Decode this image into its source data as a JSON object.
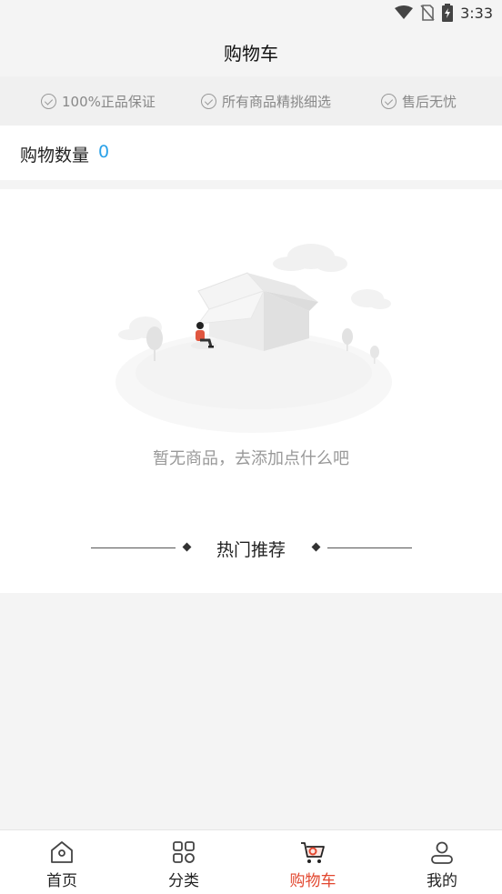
{
  "status_bar": {
    "time": "3:33",
    "icons": [
      "wifi-icon",
      "no-sim-icon",
      "battery-charging-icon"
    ]
  },
  "header": {
    "title": "购物车"
  },
  "guarantees": [
    {
      "icon": "check-circle-icon",
      "label": "100%正品保证"
    },
    {
      "icon": "check-circle-icon",
      "label": "所有商品精挑细选"
    },
    {
      "icon": "check-circle-icon",
      "label": "售后无忧"
    }
  ],
  "cart": {
    "count_label": "购物数量",
    "count": "0"
  },
  "empty_state": {
    "illustration": "empty-box-illustration",
    "message": "暂无商品，去添加点什么吧"
  },
  "recommend": {
    "title": "热门推荐"
  },
  "tab_bar": {
    "active_color": "#e2472f",
    "items": [
      {
        "icon": "home-icon",
        "label": "首页"
      },
      {
        "icon": "category-grid-icon",
        "label": "分类"
      },
      {
        "icon": "cart-icon",
        "label": "购物车",
        "active": true
      },
      {
        "icon": "profile-icon",
        "label": "我的"
      }
    ]
  }
}
